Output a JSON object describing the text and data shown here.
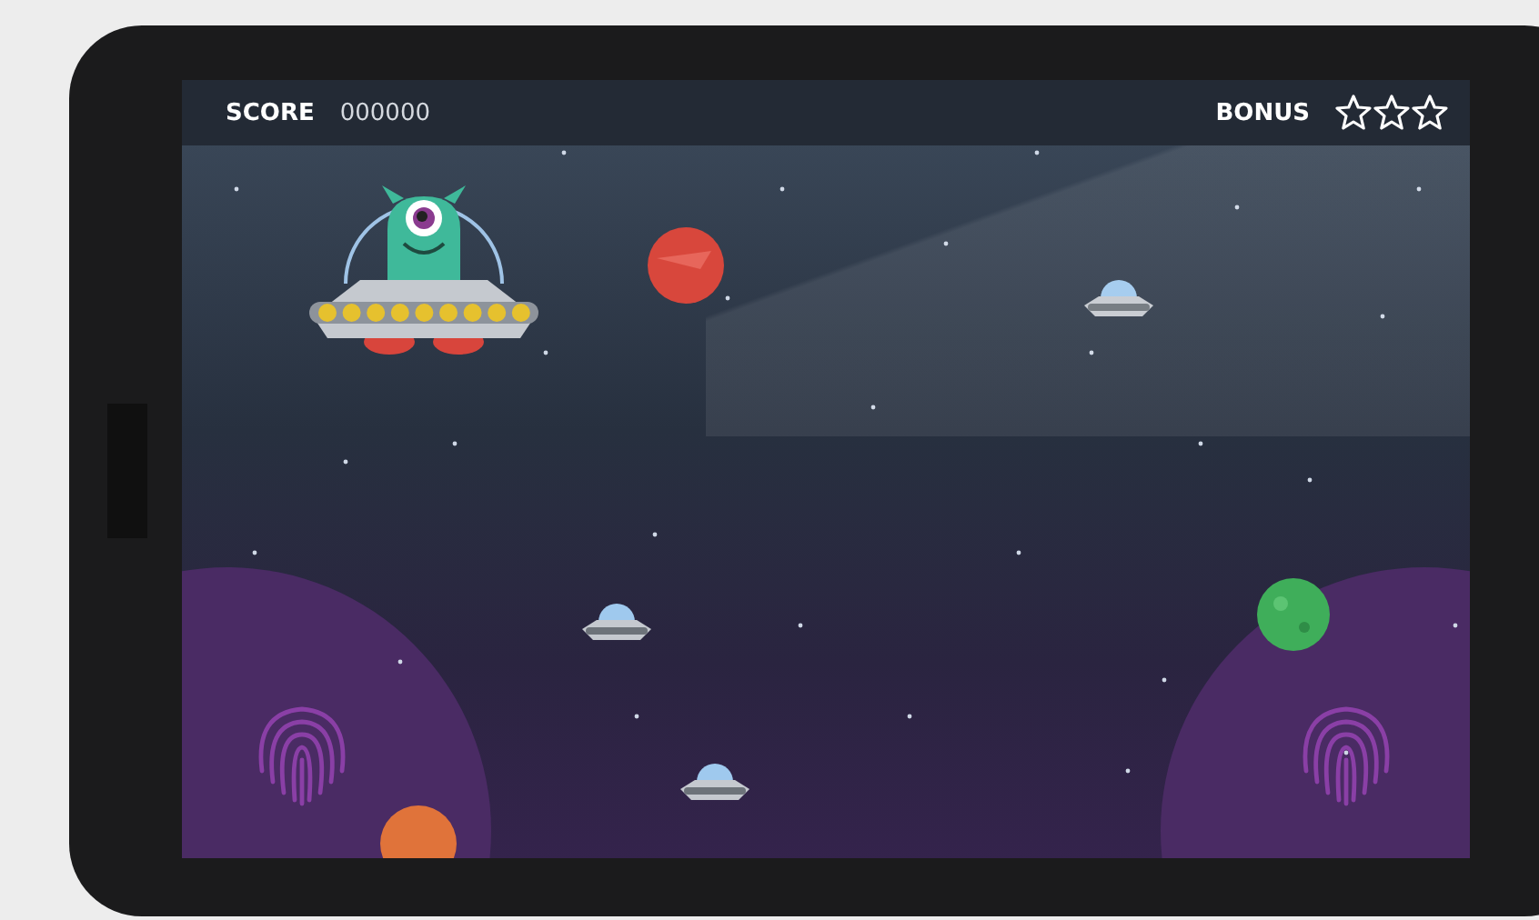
{
  "hud": {
    "score_label": "SCORE",
    "score": "000000",
    "bonus_label": "BONUS",
    "stars": 0
  }
}
